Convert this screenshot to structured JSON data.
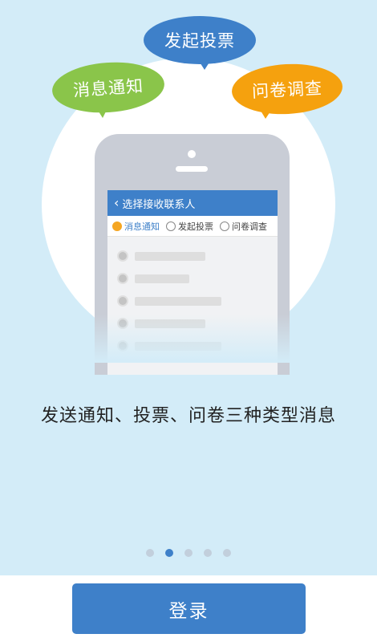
{
  "illustration": {
    "bubbles": {
      "notice": "消息通知",
      "vote": "发起投票",
      "survey": "问卷调查"
    },
    "phone_screen": {
      "header_title": "选择接收联系人",
      "back_icon": "chevron-left-icon",
      "tabs": [
        {
          "label": "消息通知",
          "selected": true
        },
        {
          "label": "发起投票",
          "selected": false
        },
        {
          "label": "问卷调查",
          "selected": false
        }
      ]
    }
  },
  "tagline": "发送通知、投票、问卷三种类型消息",
  "pager": {
    "count": 5,
    "active_index": 1
  },
  "login_button": "登录",
  "colors": {
    "background": "#d3ecf8",
    "brand_blue": "#3e80c9",
    "green": "#8ac54a",
    "orange": "#f5a10e"
  }
}
